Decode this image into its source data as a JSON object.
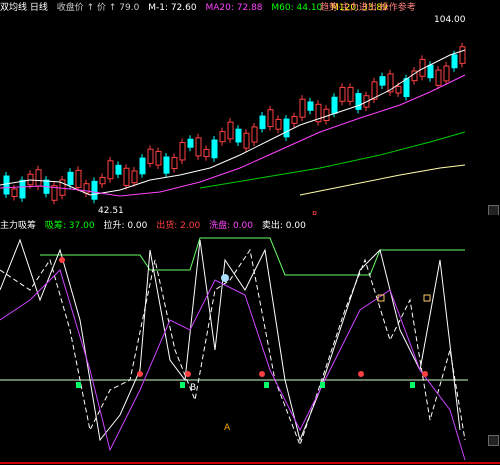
{
  "header": {
    "indicator_name": "双均线 日线",
    "params": "收盘价 ↑ 价 ↑ 79.0",
    "ma1": "M-1: 72.60",
    "ma2": "MA20: 72.88",
    "ma3": "M60: 44.10",
    "ma4": "M120: 33.89",
    "title": "趋势·主力进出·操作参考",
    "colors": {
      "ma1": "#ffffff",
      "ma2": "#ff44ff",
      "ma3": "#00ff00",
      "ma4": "#ffff00",
      "title": "#ff8080"
    }
  },
  "main_chart": {
    "high_label": "104.00",
    "low_label": "42.51",
    "marker_r": "R"
  },
  "subbar": {
    "name": "主力吸筹",
    "v1_label": "吸筹: 37.00",
    "v2_label": "拉升: 0.00",
    "v3_label": "出货: 2.00",
    "v4_label": "洗盘: 0.00",
    "v5_label": "卖出: 0.00"
  },
  "indicator_panel": {
    "signal_label": "B",
    "bottom_marker": "A"
  }
}
